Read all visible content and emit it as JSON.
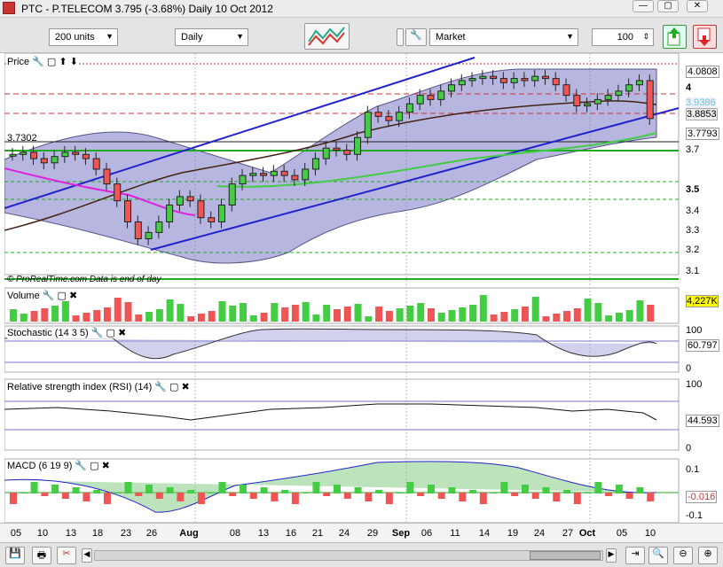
{
  "window": {
    "title": "PTC - P.TELECOM     3.795  (-3.68%)     Daily  10 Oct 2012",
    "controls": [
      "—",
      "▢",
      "✕"
    ]
  },
  "toolbar": {
    "units": "200 units",
    "period": "Daily",
    "order_type": "Market",
    "quantity": "100"
  },
  "price_panel": {
    "label": "Price",
    "ref_value": "3.7302",
    "notice": "© ProRealTime.com  Data is end of day",
    "axis": [
      "4",
      "3.7",
      "3.5",
      "3.4",
      "3.3",
      "3.2",
      "3.1"
    ],
    "badges": {
      "top": "4.0808",
      "b1": "3.9386",
      "b2": "3.8853",
      "last": "3.7793"
    }
  },
  "volume_panel": {
    "label": "Volume",
    "value": "4,227K"
  },
  "stoch_panel": {
    "label": "Stochastic (14 3 5)",
    "axis": [
      "100",
      "50",
      "0"
    ],
    "value": "60.797"
  },
  "rsi_panel": {
    "label": "Relative strength index (RSI) (14)",
    "axis": [
      "100",
      "50",
      "0"
    ],
    "value": "44.593"
  },
  "macd_panel": {
    "label": "MACD (6 19 9)",
    "axis": [
      "0.1",
      "0",
      "-0.1"
    ],
    "value": "-0.016"
  },
  "x_axis": {
    "ticks": [
      "05",
      "10",
      "13",
      "18",
      "23",
      "26",
      "Aug",
      "08",
      "13",
      "16",
      "21",
      "24",
      "29",
      "Sep",
      "06",
      "11",
      "14",
      "19",
      "24",
      "27",
      "Oct",
      "05",
      "10"
    ]
  },
  "chart_data": {
    "type": "candlestick",
    "close": [
      3.62,
      3.63,
      3.6,
      3.58,
      3.61,
      3.63,
      3.62,
      3.6,
      3.55,
      3.48,
      3.4,
      3.3,
      3.22,
      3.25,
      3.3,
      3.38,
      3.42,
      3.4,
      3.32,
      3.3,
      3.38,
      3.48,
      3.52,
      3.53,
      3.52,
      3.54,
      3.52,
      3.5,
      3.55,
      3.6,
      3.65,
      3.64,
      3.62,
      3.7,
      3.82,
      3.8,
      3.78,
      3.82,
      3.86,
      3.9,
      3.88,
      3.92,
      3.95,
      3.97,
      3.98,
      3.99,
      3.98,
      3.96,
      3.98,
      3.97,
      3.99,
      3.98,
      3.95,
      3.9,
      3.85,
      3.86,
      3.88,
      3.9,
      3.92,
      3.95,
      3.97,
      3.79
    ]
  }
}
